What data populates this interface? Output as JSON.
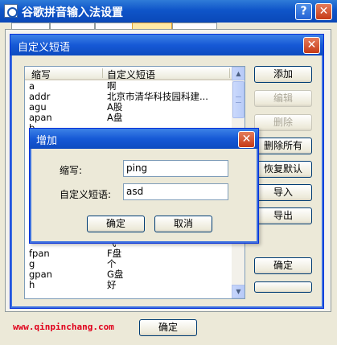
{
  "main": {
    "title": "谷歌拼音输入法设置",
    "help_label": "?",
    "close_label": "✕",
    "ok_label": "确定"
  },
  "watermark": "www.qinpinchang.com",
  "dialog": {
    "title": "自定义短语",
    "close_label": "✕",
    "columns": [
      "缩写",
      "自定义短语"
    ],
    "rows": [
      {
        "abbr": "a",
        "phrase": "啊"
      },
      {
        "abbr": "addr",
        "phrase": "北京市清华科技园科建..."
      },
      {
        "abbr": "agu",
        "phrase": "A股"
      },
      {
        "abbr": "apan",
        "phrase": "A盘"
      },
      {
        "abbr": "b",
        "phrase": ""
      },
      {
        "abbr": "",
        "phrase": ""
      },
      {
        "abbr": "",
        "phrase": ""
      },
      {
        "abbr": "",
        "phrase": ""
      },
      {
        "abbr": "",
        "phrase": ""
      },
      {
        "abbr": "",
        "phrase": ""
      },
      {
        "abbr": "",
        "phrase": ""
      },
      {
        "abbr": "",
        "phrase": ""
      },
      {
        "abbr": "",
        "phrase": ""
      },
      {
        "abbr": "",
        "phrase": ""
      },
      {
        "abbr": "",
        "phrase": ""
      },
      {
        "abbr": "",
        "phrase": "飞"
      },
      {
        "abbr": "fpan",
        "phrase": "F盘"
      },
      {
        "abbr": "g",
        "phrase": "个"
      },
      {
        "abbr": "gpan",
        "phrase": "G盘"
      },
      {
        "abbr": "h",
        "phrase": "好"
      }
    ],
    "buttons": {
      "add": "添加",
      "edit": "编辑",
      "delete": "删除",
      "delete_all": "删除所有",
      "restore_default": "恢复默认",
      "import": "导入",
      "export": "导出",
      "ok": "确定"
    }
  },
  "add_dialog": {
    "title": "增加",
    "close_label": "✕",
    "abbr_label": "缩写:",
    "abbr_value": "ping",
    "phrase_label": "自定义短语:",
    "phrase_value": "asd",
    "ok_label": "确定",
    "cancel_label": "取消"
  }
}
